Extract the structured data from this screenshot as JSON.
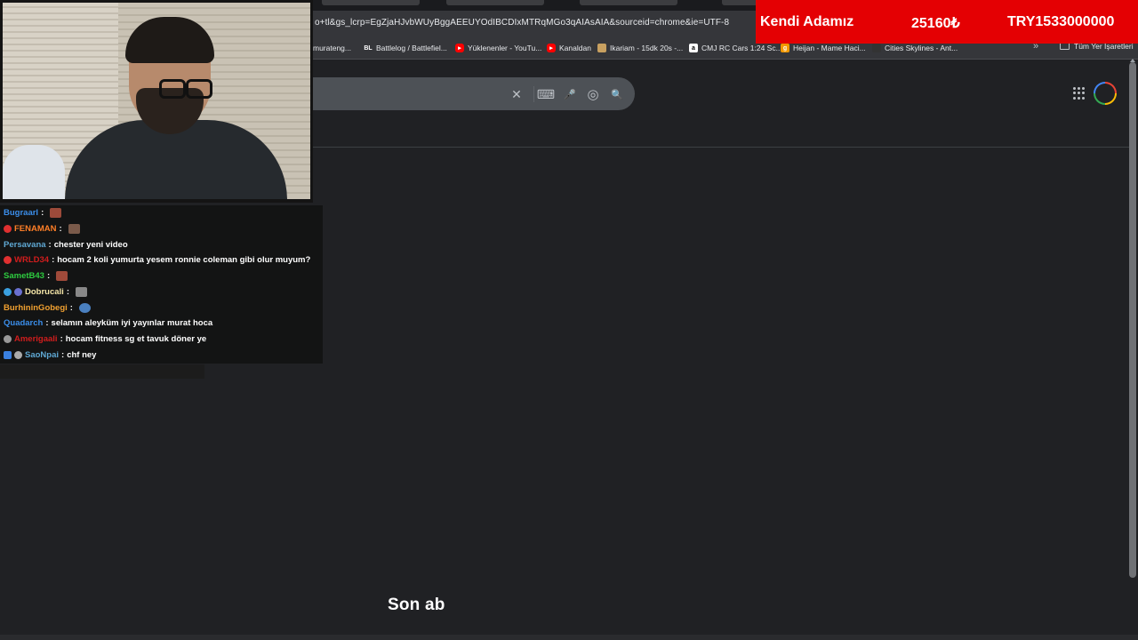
{
  "browser": {
    "url": "o+tl&gs_lcrp=EgZjaHJvbWUyBggAEEUYOdIBCDIxMTRqMGo3qAIAsAIA&sourceid=chrome&ie=UTF-8",
    "bookmarks": [
      {
        "label": "murateng...",
        "icon": "page-icon",
        "color": "#5f6368"
      },
      {
        "label": "Battlelog / Battlefiel...",
        "icon": "battlelog-icon",
        "color": "#35363a"
      },
      {
        "label": "Yüklenenler - YouTu...",
        "icon": "youtube-icon",
        "color": "#ff0000"
      },
      {
        "label": "Kanaldan",
        "icon": "youtube-icon",
        "color": "#ff0000"
      },
      {
        "label": "Ikariam - 15dk 20s -...",
        "icon": "ikariam-icon",
        "color": "#c8a060"
      },
      {
        "label": "CMJ RC Cars 1:24 Sc...",
        "icon": "amazon-icon",
        "color": "#ffffff"
      },
      {
        "label": "Heijan - Mame Haci...",
        "icon": "heijan-icon",
        "color": "#f29900"
      },
      {
        "label": "Cities Skylines - Ant...",
        "icon": "cities-icon",
        "color": "#333333"
      }
    ],
    "bookmarks_more": "»",
    "all_bookmarks": "Tüm Yer İşaretleri"
  },
  "search": {
    "clear_icon": "✕",
    "keyboard_icon": "⌨",
    "mic_icon": "🎤",
    "lens_icon": "◎",
    "search_icon": "🔍"
  },
  "sub_banner": {
    "name": "Kendi Adamız",
    "amount": "25160₺",
    "total": "TRY1533000000"
  },
  "chat": {
    "messages": [
      {
        "user": "Bugraarl",
        "user_color": "#3b8eea",
        "text": "",
        "emote": true,
        "badge": null
      },
      {
        "user": "FENAMAN",
        "user_color": "#ff7f27",
        "text": "",
        "emote": true,
        "badge": "#e03030"
      },
      {
        "user": "Persavana",
        "user_color": "#5fa8d3",
        "text": "chester yeni video",
        "emote": false,
        "badge": null
      },
      {
        "user": "WRLD34",
        "user_color": "#d11d1d",
        "text": "hocam 2 koli yumurta yesem ronnie coleman gibi olur muyum?",
        "emote": false,
        "badge": "#e03030"
      },
      {
        "user": "SametB43",
        "user_color": "#2ecc40",
        "text": "",
        "emote": true,
        "badge": null
      },
      {
        "user": "Dobrucali",
        "user_color": "#f5e6a8",
        "text": "",
        "emote": true,
        "badge": "#3aa0e0"
      },
      {
        "user": "BurhininGobegi",
        "user_color": "#f0a030",
        "text": "",
        "emote": true,
        "badge": null
      },
      {
        "user": "Quadarch",
        "user_color": "#3b8eea",
        "text": "selamın aleyküm iyi yayınlar murat hoca",
        "emote": false,
        "badge": null
      },
      {
        "user": "Amerigaali",
        "user_color": "#d11d1d",
        "text": "hocam fitness sg et tavuk döner ye",
        "emote": false,
        "badge": "#999999"
      },
      {
        "user": "SaoNpai",
        "user_color": "#5fa8d3",
        "text": "chf ney",
        "emote": false,
        "badge": "#3a80e0"
      }
    ]
  },
  "caption": "Son ab"
}
